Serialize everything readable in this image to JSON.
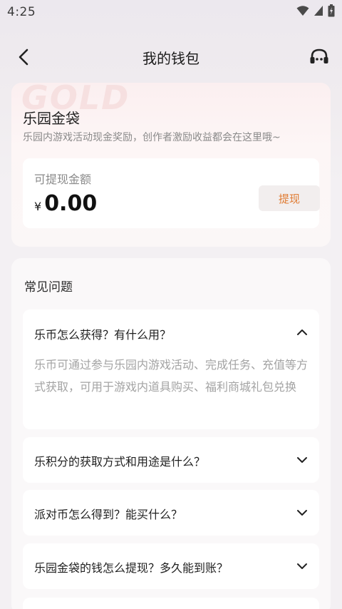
{
  "status_bar": {
    "time": "4:25"
  },
  "nav": {
    "title": "我的钱包"
  },
  "wallet": {
    "watermark": "GOLD",
    "title": "乐园金袋",
    "description": "乐园内游戏活动现金奖励，创作者激励收益都会在这里哦~",
    "balance_label": "可提现金额",
    "currency": "¥",
    "amount": "0.00",
    "withdraw_label": "提现"
  },
  "faq": {
    "title": "常见问题",
    "items": [
      {
        "question": "乐币怎么获得？有什么用？",
        "answer": "乐币可通过参与乐园内游戏活动、完成任务、充值等方式获取，可用于游戏内道具购买、福利商城礼包兑换",
        "expanded": true
      },
      {
        "question": "乐积分的获取方式和用途是什么？",
        "expanded": false
      },
      {
        "question": "派对币怎么得到？能买什么？",
        "expanded": false
      },
      {
        "question": "乐园金袋的钱怎么提现？多久能到账？",
        "expanded": false
      }
    ]
  },
  "colors": {
    "accent": "#e07b32",
    "page_bg": "#f3f0f3"
  }
}
